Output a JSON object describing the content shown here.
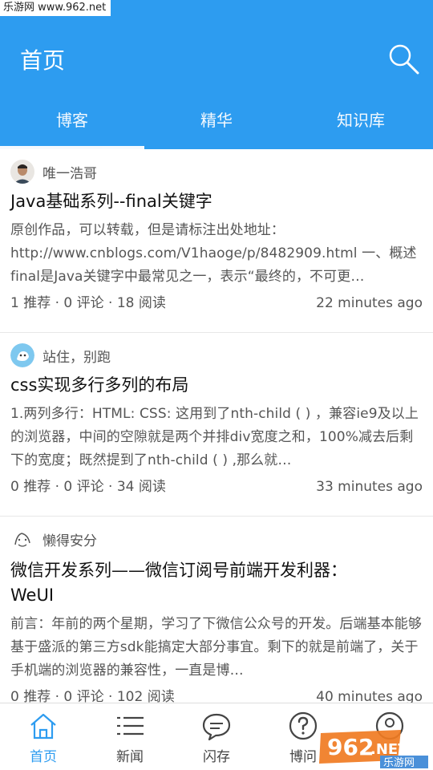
{
  "watermark": "乐游网 www.962.net",
  "header": {
    "title": "首页",
    "search_icon": "search-icon",
    "color": "#2d9cf0"
  },
  "tabs": [
    {
      "label": "博客",
      "active": true
    },
    {
      "label": "精华",
      "active": false
    },
    {
      "label": "知识库",
      "active": false
    }
  ],
  "posts": [
    {
      "author": "唯一浩哥",
      "title": "Java基础系列--final关键字",
      "summary": "原创作品，可以转载，但是请标注出处地址：http://www.cnblogs.com/V1haoge/p/8482909.html 一、概述 final是Java关键字中最常见之一，表示“最终的，不可更…",
      "stats": "1 推荐 · 0 评论 · 18 阅读",
      "time": "22 minutes ago"
    },
    {
      "author": "站住，别跑",
      "title": "css实现多行多列的布局",
      "summary": "1.两列多行：HTML: CSS: 这用到了nth-child ( ) ，兼容ie9及以上的浏览器，中间的空隙就是两个并排div宽度之和，100%减去后剩下的宽度；既然提到了nth-child ( ) ,那么就…",
      "stats": "0 推荐 · 0 评论 · 34 阅读",
      "time": "33 minutes ago"
    },
    {
      "author": "懒得安分",
      "title": "微信开发系列——微信订阅号前端开发利器：WeUI",
      "summary": "前言：年前的两个星期，学习了下微信公众号的开发。后端基本能够基于盛派的第三方sdk能搞定大部分事宜。剩下的就是前端了，关于手机端的浏览器的兼容性，一直是博…",
      "stats": "0 推荐 · 0 评论 · 102 阅读",
      "time": "40 minutes ago"
    }
  ],
  "bottom_nav": [
    {
      "label": "首页",
      "icon": "home-icon",
      "active": true
    },
    {
      "label": "新闻",
      "icon": "news-list-icon",
      "active": false
    },
    {
      "label": "闪存",
      "icon": "chat-bubble-icon",
      "active": false
    },
    {
      "label": "博问",
      "icon": "question-icon",
      "active": false
    },
    {
      "label": "我",
      "icon": "profile-icon",
      "active": false
    }
  ],
  "logo": {
    "number": "962",
    "suffix": ".NET",
    "cn": "乐游网"
  }
}
